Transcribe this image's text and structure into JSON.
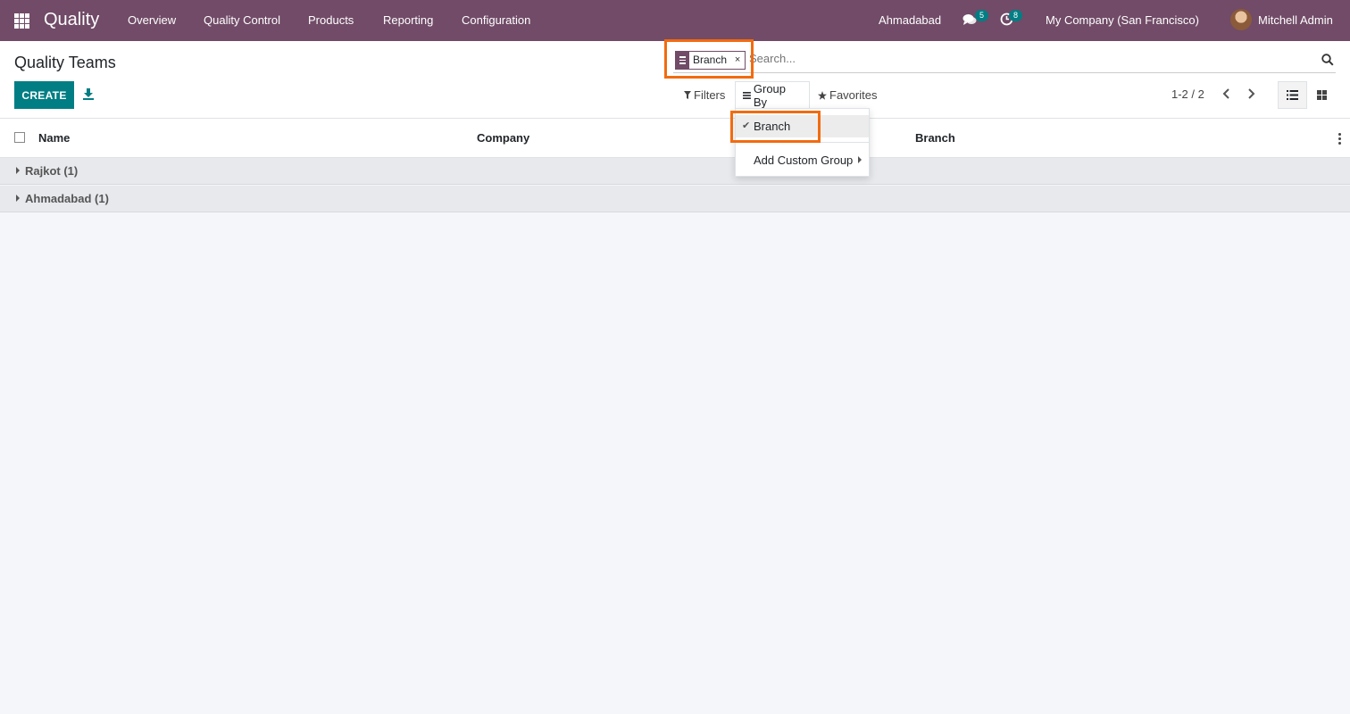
{
  "navbar": {
    "app_name": "Quality",
    "menu": [
      "Overview",
      "Quality Control",
      "Products",
      "Reporting",
      "Configuration"
    ],
    "branch": "Ahmadabad",
    "messages_count": "5",
    "activities_count": "8",
    "company": "My Company (San Francisco)",
    "user": "Mitchell Admin",
    "accent_color": "#714b67"
  },
  "control_panel": {
    "title": "Quality Teams",
    "create_label": "CREATE",
    "search": {
      "facet_label": "Branch",
      "facet_remove": "×",
      "placeholder": "Search..."
    },
    "filters_label": "Filters",
    "groupby_label": "Group By",
    "favorites_label": "Favorites",
    "pager": "1-2 / 2"
  },
  "groupby_dropdown": {
    "selected_item": "Branch",
    "check": "✔",
    "custom_group_label": "Add Custom Group"
  },
  "list": {
    "columns": [
      "Name",
      "Company",
      "Branch"
    ],
    "groups": [
      {
        "label": "Rajkot (1)"
      },
      {
        "label": "Ahmadabad (1)"
      }
    ]
  },
  "highlight_color": "#f26b0f"
}
